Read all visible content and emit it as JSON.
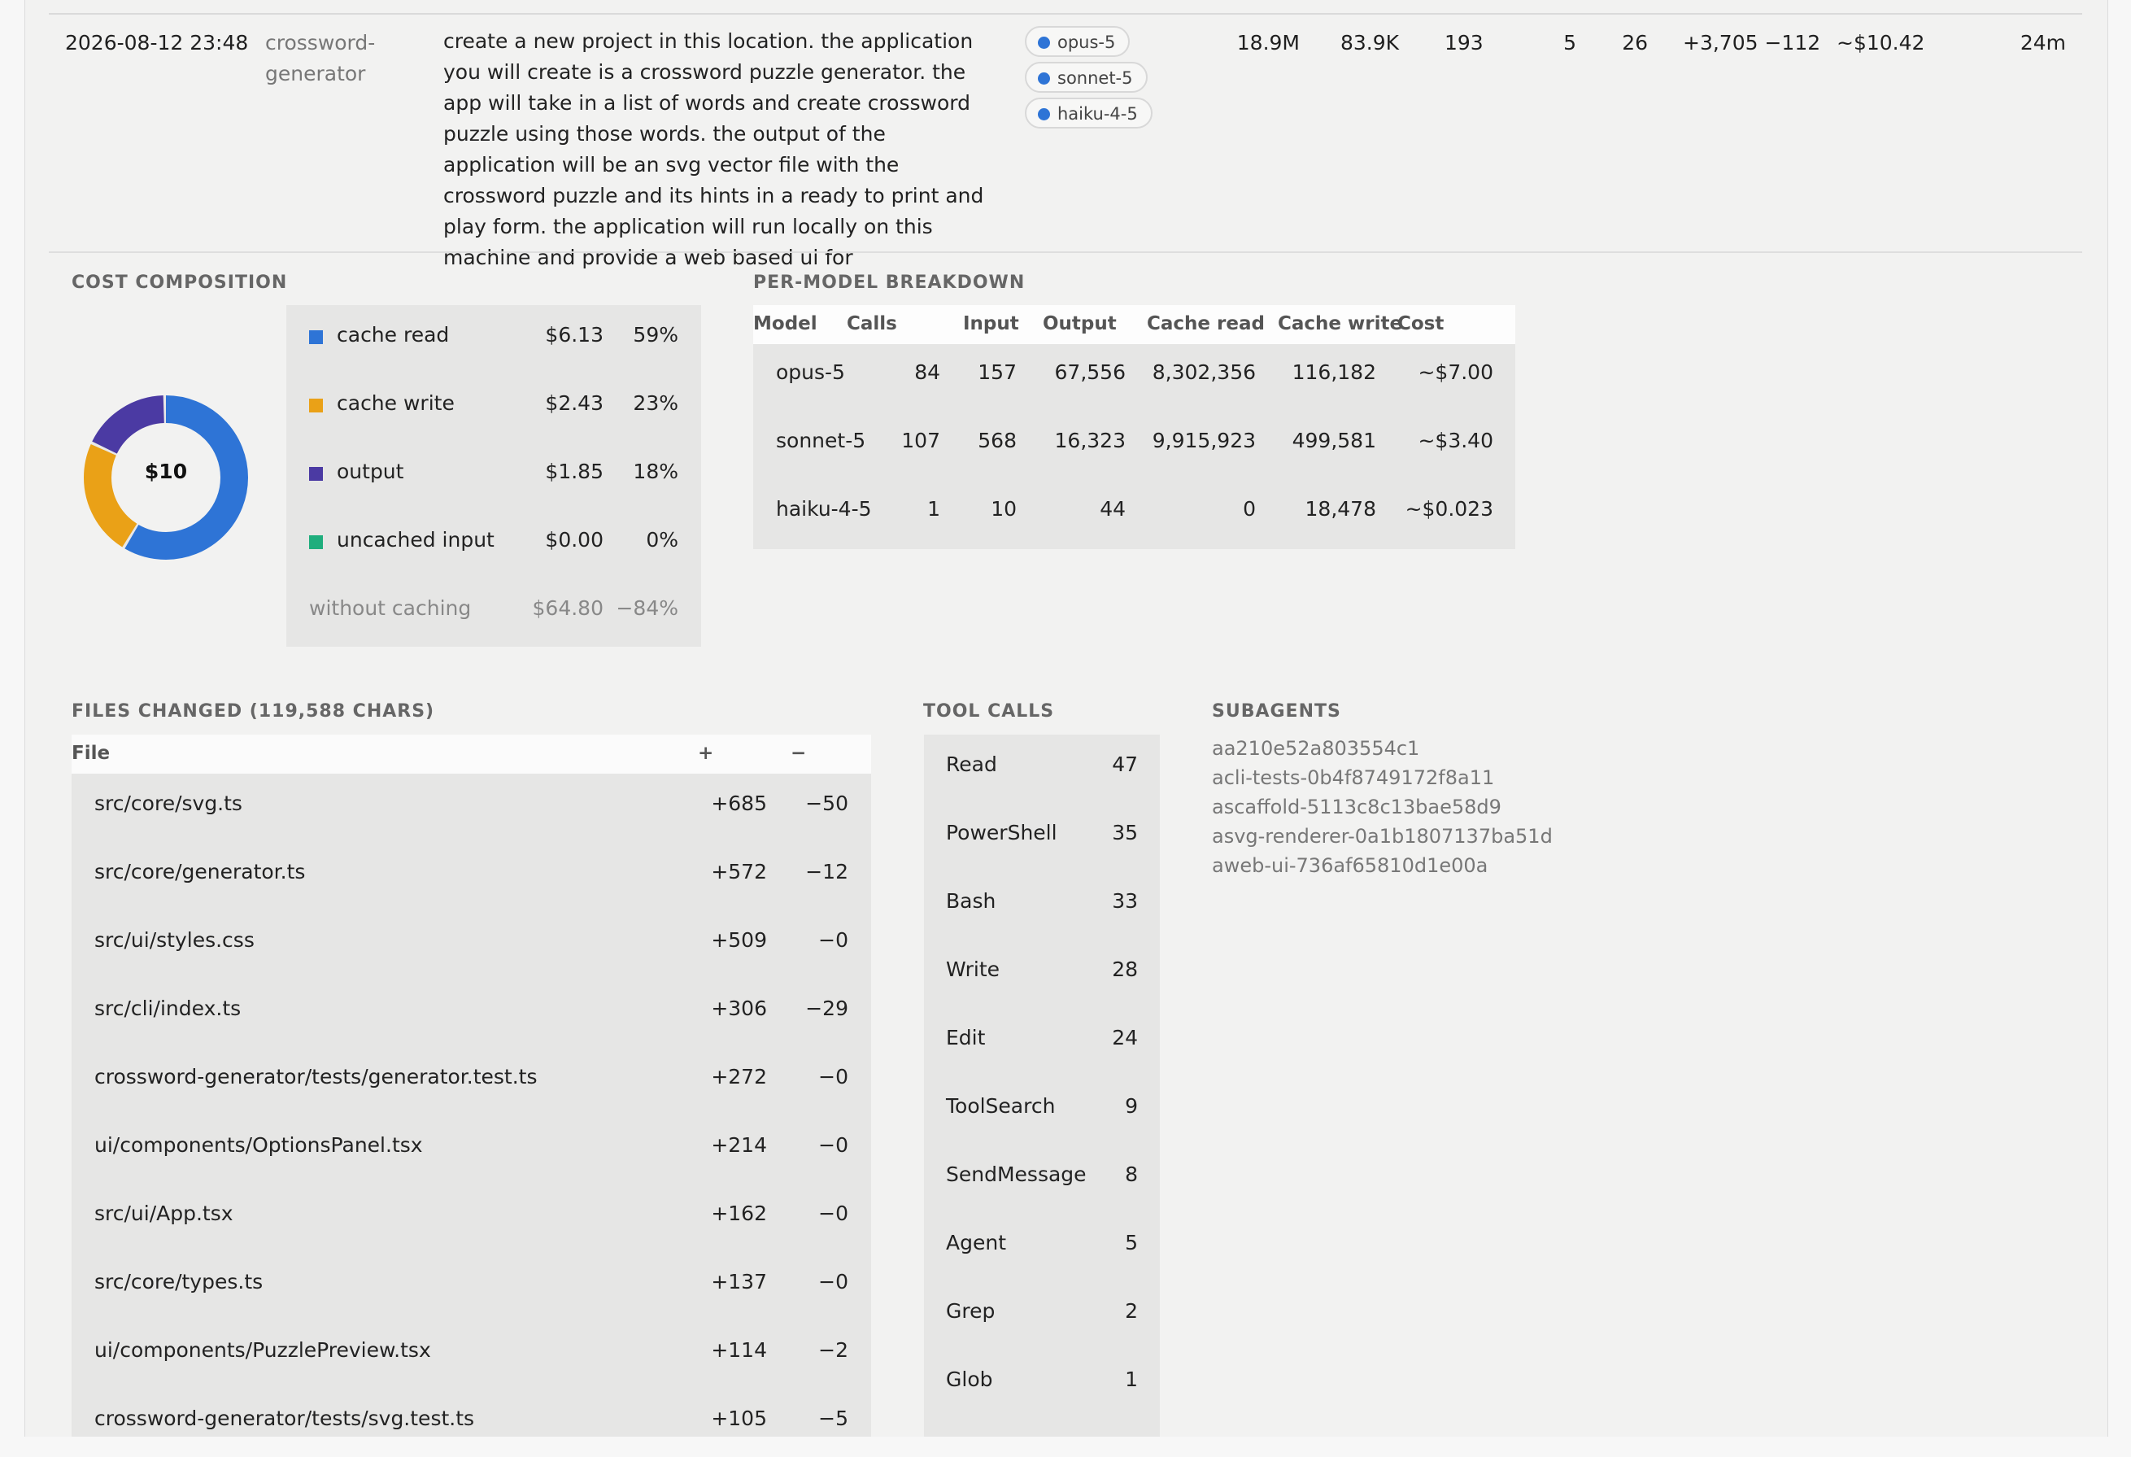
{
  "session": {
    "datetime": "2026-08-12 23:48",
    "project_line1": "crossword-",
    "project_line2": "generator",
    "prompt": "create a new project in this location. the application you will create is a crossword puzzle generator. the app will take in a list of words and create crossword puzzle using those words. the output of the application will be an svg vector file with the crossword puzzle and its hints in a ready to print and play form. the application will run locally on this machine and provide a web based ui for",
    "models": [
      "opus-5",
      "sonnet-5",
      "haiku-4-5"
    ],
    "tokens": "18.9M",
    "output": "83.9K",
    "calls": "193",
    "col_a": "5",
    "col_b": "26",
    "lines": "+3,705 −112",
    "cost": "~$10.42",
    "duration": "24m"
  },
  "cost_composition": {
    "title": "COST COMPOSITION",
    "total_label": "$10",
    "items": [
      {
        "name": "cache read",
        "value": "$6.13",
        "pct": "59%",
        "color": "#2e74d6",
        "share": 0.589
      },
      {
        "name": "cache write",
        "value": "$2.43",
        "pct": "23%",
        "color": "#eaa117",
        "share": 0.233
      },
      {
        "name": "output",
        "value": "$1.85",
        "pct": "18%",
        "color": "#4b3aa3",
        "share": 0.178
      },
      {
        "name": "uncached input",
        "value": "$0.00",
        "pct": "0%",
        "color": "#1fae7d",
        "share": 0.0
      }
    ],
    "without_caching": {
      "name": "without caching",
      "value": "$64.80",
      "pct": "−84%"
    }
  },
  "per_model": {
    "title": "PER-MODEL BREAKDOWN",
    "headers": [
      "Model",
      "Calls",
      "Input",
      "Output",
      "Cache read",
      "Cache write",
      "Cost"
    ],
    "rows": [
      [
        "opus-5",
        "84",
        "157",
        "67,556",
        "8,302,356",
        "116,182",
        "~$7.00"
      ],
      [
        "sonnet-5",
        "107",
        "568",
        "16,323",
        "9,915,923",
        "499,581",
        "~$3.40"
      ],
      [
        "haiku-4-5",
        "1",
        "10",
        "44",
        "0",
        "18,478",
        "~$0.023"
      ]
    ]
  },
  "files_changed": {
    "title": "FILES CHANGED (119,588 CHARS)",
    "headers": {
      "file": "File",
      "add": "+",
      "del": "−"
    },
    "rows": [
      {
        "file": "src/core/svg.ts",
        "add": "+685",
        "del": "−50"
      },
      {
        "file": "src/core/generator.ts",
        "add": "+572",
        "del": "−12"
      },
      {
        "file": "src/ui/styles.css",
        "add": "+509",
        "del": "−0"
      },
      {
        "file": "src/cli/index.ts",
        "add": "+306",
        "del": "−29"
      },
      {
        "file": "crossword-generator/tests/generator.test.ts",
        "add": "+272",
        "del": "−0"
      },
      {
        "file": "ui/components/OptionsPanel.tsx",
        "add": "+214",
        "del": "−0"
      },
      {
        "file": "src/ui/App.tsx",
        "add": "+162",
        "del": "−0"
      },
      {
        "file": "src/core/types.ts",
        "add": "+137",
        "del": "−0"
      },
      {
        "file": "ui/components/PuzzlePreview.tsx",
        "add": "+114",
        "del": "−2"
      },
      {
        "file": "crossword-generator/tests/svg.test.ts",
        "add": "+105",
        "del": "−5"
      }
    ]
  },
  "tool_calls": {
    "title": "TOOL CALLS",
    "rows": [
      {
        "name": "Read",
        "count": "47"
      },
      {
        "name": "PowerShell",
        "count": "35"
      },
      {
        "name": "Bash",
        "count": "33"
      },
      {
        "name": "Write",
        "count": "28"
      },
      {
        "name": "Edit",
        "count": "24"
      },
      {
        "name": "ToolSearch",
        "count": "9"
      },
      {
        "name": "SendMessage",
        "count": "8"
      },
      {
        "name": "Agent",
        "count": "5"
      },
      {
        "name": "Grep",
        "count": "2"
      },
      {
        "name": "Glob",
        "count": "1"
      }
    ]
  },
  "subagents": {
    "title": "SUBAGENTS",
    "items": [
      "aa210e52a803554c1",
      "acli-tests-0b4f8749172f8a11",
      "ascaffold-5113c8c13bae58d9",
      "asvg-renderer-0a1b1807137ba51d",
      "aweb-ui-736af65810d1e00a"
    ]
  }
}
